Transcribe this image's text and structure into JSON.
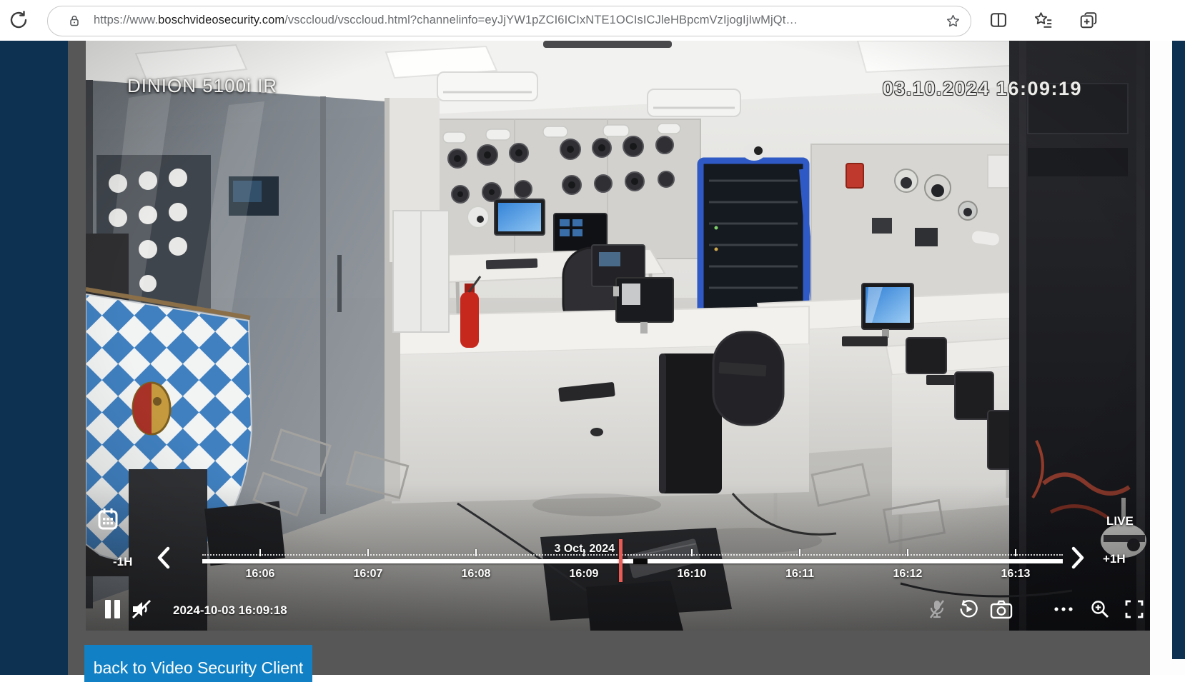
{
  "browser": {
    "reload_icon": "circular-arrow-reload",
    "url": {
      "scheme_prefix": "https://www.",
      "domain": "boschvideosecurity.com",
      "path_and_query": "/vsccloud/vsccloud.html?channelinfo=eyJjYW1pZCI6ICIxNTE1OCIsICJleHBpcmVzIjogIjIwMjQt…"
    },
    "toolbar_icons": [
      "site-info-lock",
      "add-favorite-star",
      "split-screen",
      "favorites-hub",
      "collections"
    ]
  },
  "player": {
    "camera_label": "DINION 5100i IR",
    "osd_timestamp": "03.10.2024 16:09:19",
    "live_badge": "LIVE",
    "playback_time": "2024-10-03 16:09:18",
    "date_label": "3 Oct, 2024",
    "timeline": {
      "jump_back_label": "-1H",
      "jump_forward_label": "+1H",
      "ticks": [
        "16:06",
        "16:07",
        "16:08",
        "16:09",
        "16:10",
        "16:11",
        "16:12",
        "16:13"
      ]
    },
    "control_icons_left": [
      "pause",
      "volume-muted"
    ],
    "control_icons_right": [
      "microphone-off",
      "playback-history",
      "snapshot-camera",
      "more-options",
      "zoom-in",
      "fullscreen"
    ],
    "calendar_icon": "calendar"
  },
  "footer": {
    "back_button_label": "back to Video Security Client"
  },
  "colors": {
    "sidebar_navy": "#0d3150",
    "content_gray": "#575757",
    "bosch_blue": "#1180c4",
    "playhead_red": "#e85c55",
    "flag_blue": "#4080c0",
    "rack_blue": "#2f5ac6"
  }
}
